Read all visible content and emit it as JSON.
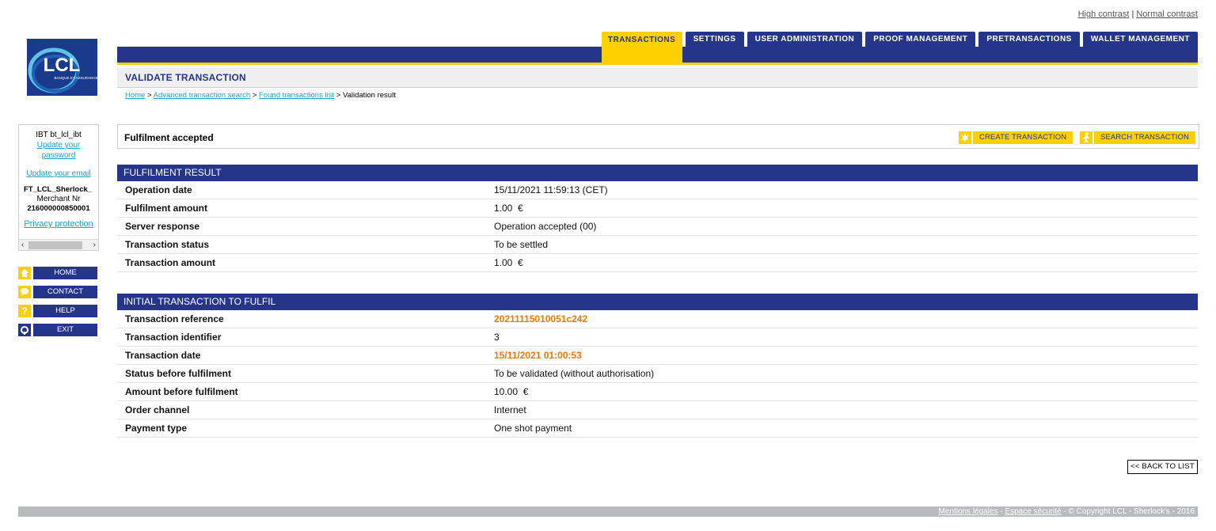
{
  "contrast": {
    "high": "High contrast",
    "separator": "|",
    "normal": "Normal contrast"
  },
  "logo": {
    "text": "LCL",
    "tagline": "BANQUE ET ASSURANCE"
  },
  "tabs": [
    {
      "label": "TRANSACTIONS",
      "active": true
    },
    {
      "label": "SETTINGS",
      "active": false
    },
    {
      "label": "USER ADMINISTRATION",
      "active": false
    },
    {
      "label": "PROOF MANAGEMENT",
      "active": false
    },
    {
      "label": "PRETRANSACTIONS",
      "active": false
    },
    {
      "label": "WALLET MANAGEMENT",
      "active": false
    }
  ],
  "page_title": "VALIDATE TRANSACTION",
  "breadcrumb": {
    "items": [
      "Home",
      "Advanced transaction search",
      "Found transactions list"
    ],
    "separator": ">",
    "current": "Validation result"
  },
  "user": {
    "name": "IBT bt_lcl_ibt",
    "update_password": "Update your password",
    "update_email": "Update your email",
    "merchant_name": "FT_LCL_Sherlock_",
    "merchant_nr_label": "Merchant Nr",
    "merchant_nr": "216000000850001",
    "privacy": "Privacy protection"
  },
  "sidenav": [
    {
      "label": "HOME",
      "icon": "home-icon"
    },
    {
      "label": "CONTACT",
      "icon": "speech-bubble-icon"
    },
    {
      "label": "HELP",
      "icon": "question-icon"
    },
    {
      "label": "EXIT",
      "icon": "power-icon"
    }
  ],
  "action_box": {
    "message": "Fulfilment accepted",
    "create_label": "CREATE TRANSACTION",
    "search_label": "SEARCH TRANSACTION"
  },
  "fulfilment_result": {
    "title": "FULFILMENT RESULT",
    "rows": [
      {
        "label": "Operation date",
        "value": "15/11/2021 11:59:13 (CET)"
      },
      {
        "label": "Fulfilment amount",
        "value": "1.00  €"
      },
      {
        "label": "Server response",
        "value": "Operation accepted (00)"
      },
      {
        "label": "Transaction status",
        "value": "To be settled"
      },
      {
        "label": "Transaction amount",
        "value": "1.00  €"
      }
    ]
  },
  "initial_transaction": {
    "title": "INITIAL TRANSACTION TO FULFIL",
    "rows": [
      {
        "label": "Transaction reference",
        "value": "20211115010051c242",
        "highlight": true
      },
      {
        "label": "Transaction identifier",
        "value": "3",
        "highlight": false
      },
      {
        "label": "Transaction date",
        "value": "15/11/2021 01:00:53",
        "highlight": true
      },
      {
        "label": "Status before fulfilment",
        "value": "To be validated (without authorisation)",
        "highlight": false
      },
      {
        "label": "Amount before fulfilment",
        "value": "10.00  €",
        "highlight": false
      },
      {
        "label": "Order channel",
        "value": "Internet",
        "highlight": false
      },
      {
        "label": "Payment type",
        "value": "One shot payment",
        "highlight": false
      }
    ]
  },
  "back_button": "<< BACK TO LIST",
  "footer": {
    "links": [
      "Mentions légales",
      "Espace sécurité"
    ],
    "separator": " - ",
    "copyright": "© Copyright LCL - Sherlock's - 2016"
  },
  "colors": {
    "navy": "#25358a",
    "yellow": "#ffd000",
    "link": "#1aa3c9",
    "highlight": "#f07800",
    "footer": "#b8bcbc"
  }
}
